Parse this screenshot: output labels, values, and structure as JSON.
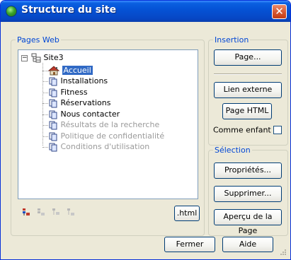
{
  "window": {
    "title": "Structure du site"
  },
  "pages_group": {
    "label": "Pages Web",
    "root": "Site3",
    "items": [
      {
        "label": "Accueil",
        "state": "selected"
      },
      {
        "label": "Installations",
        "state": "normal"
      },
      {
        "label": "Fitness",
        "state": "normal"
      },
      {
        "label": "Réservations",
        "state": "normal"
      },
      {
        "label": "Nous contacter",
        "state": "normal"
      },
      {
        "label": "Résultats de la recherche",
        "state": "disabled"
      },
      {
        "label": "Politique de confidentialité",
        "state": "disabled"
      },
      {
        "label": "Conditions d'utilisation",
        "state": "disabled"
      }
    ],
    "html_button": ".html"
  },
  "insertion": {
    "label": "Insertion",
    "page_button": "Page...",
    "external_link_button": "Lien externe",
    "html_page_button": "Page HTML",
    "as_child_label": "Comme enfant",
    "as_child_checked": false
  },
  "selection": {
    "label": "Sélection",
    "properties_button": "Propriétés...",
    "delete_button": "Supprimer...",
    "preview_button": "Aperçu de la Page"
  },
  "footer": {
    "close_button": "Fermer",
    "help_button": "Aide"
  }
}
